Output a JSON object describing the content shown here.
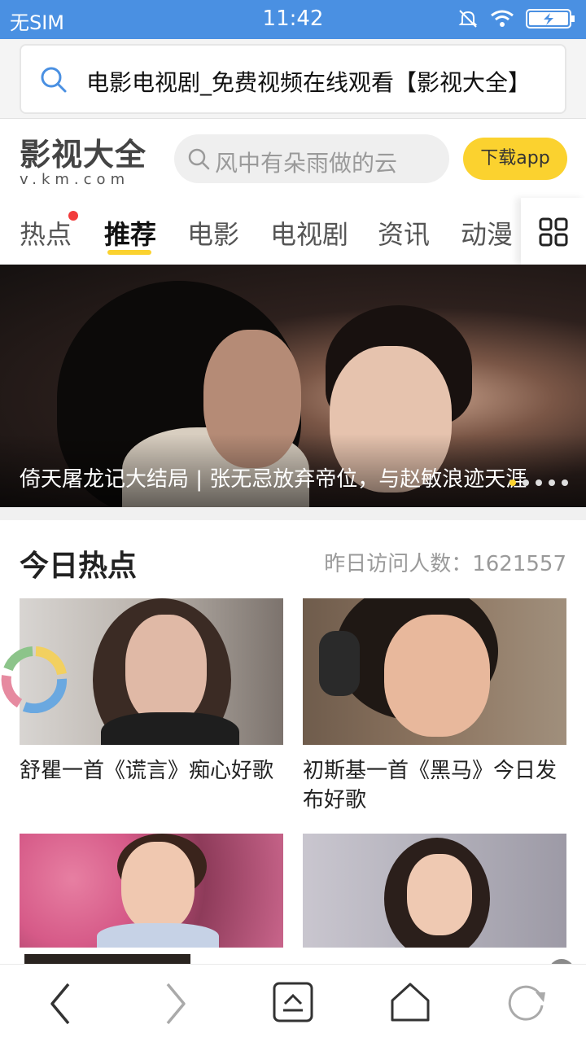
{
  "status_bar": {
    "carrier": "无SIM",
    "time": "11:42"
  },
  "url_bar": {
    "text": "电影电视剧_免费视频在线观看【影视大全】"
  },
  "site": {
    "logo_cn": "影视大全",
    "logo_en": "v.km.com",
    "search_placeholder": "风中有朵雨做的云",
    "download_label": "下载app"
  },
  "nav": {
    "tabs": [
      {
        "label": "热点",
        "badge": true
      },
      {
        "label": "推荐",
        "active": true
      },
      {
        "label": "电影"
      },
      {
        "label": "电视剧"
      },
      {
        "label": "资讯"
      },
      {
        "label": "动漫"
      }
    ]
  },
  "banner": {
    "caption": "倚天屠龙记大结局 | 张无忌放弃帝位，与赵敏浪迹天涯"
  },
  "hot": {
    "title": "今日热点",
    "visits_label": "昨日访问人数：",
    "visits_value": "1621557",
    "cards": [
      {
        "title": "舒瞿一首《谎言》痴心好歌"
      },
      {
        "title": "初斯基一首《黑马》今日发布好歌"
      },
      {
        "title": ""
      },
      {
        "title": ""
      }
    ]
  },
  "colors": {
    "status_bar": "#4a90e2",
    "accent": "#fbd22f",
    "badge": "#f23b3b"
  }
}
